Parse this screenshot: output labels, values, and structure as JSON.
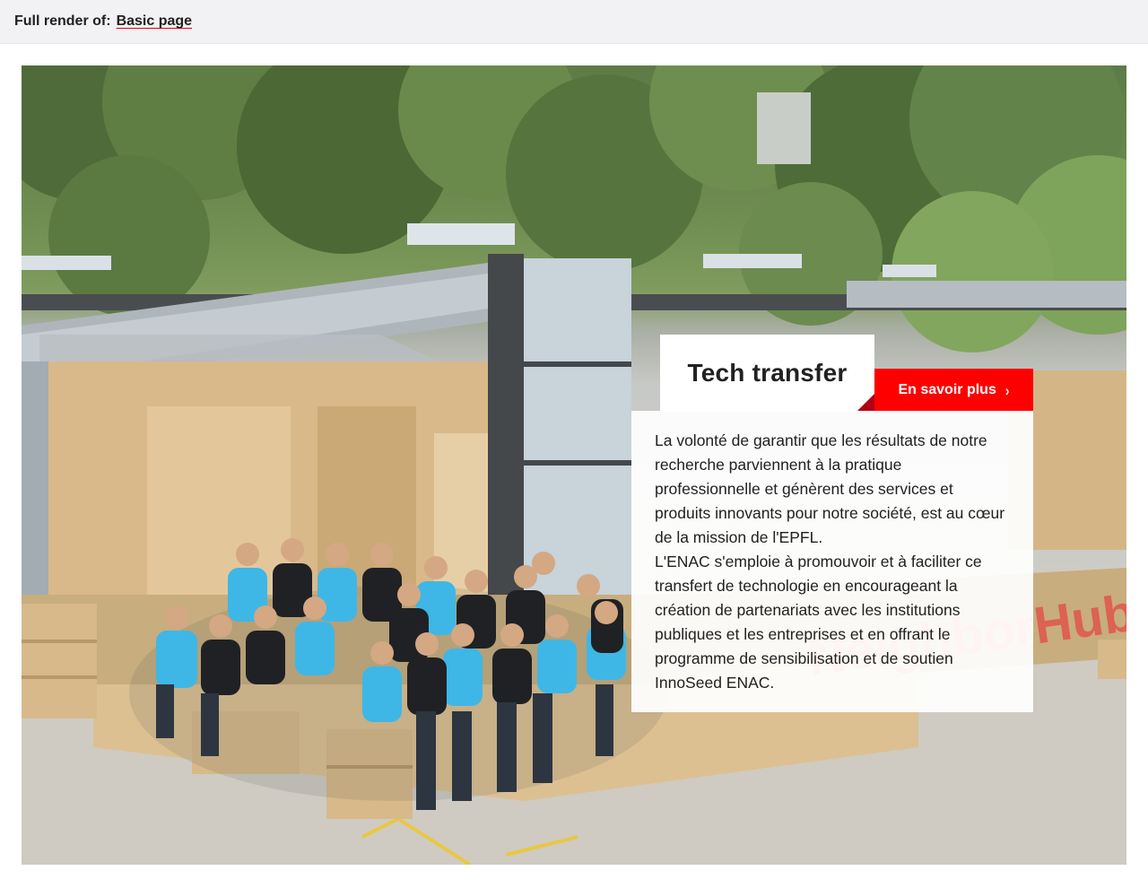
{
  "topbar": {
    "prefix": "Full render of:",
    "link_label": "Basic page"
  },
  "hero": {
    "image_alt": "",
    "title": "Tech transfer",
    "cta_label": "En savoir plus",
    "cta_icon": "chevron-right-icon",
    "paragraph_1": "La volonté de garantir que les résultats de notre recherche parviennent à la pratique professionnelle et génèrent des services et produits innovants pour notre société, est au cœur de la mission de l'EPFL.",
    "paragraph_2": "L'ENAC s'emploie à promouvoir et à faciliter ce transfert de technologie en encourageant la création de partenariats avec les institutions publiques et les entreprises et en offrant le programme de sensibilisation et de soutien InnoSeed ENAC.",
    "signage_text": "NeighborHub"
  },
  "colors": {
    "accent": "#ff0000",
    "accent_dark": "#b30015",
    "topbar_bg": "#f2f2f4",
    "text": "#212121"
  }
}
